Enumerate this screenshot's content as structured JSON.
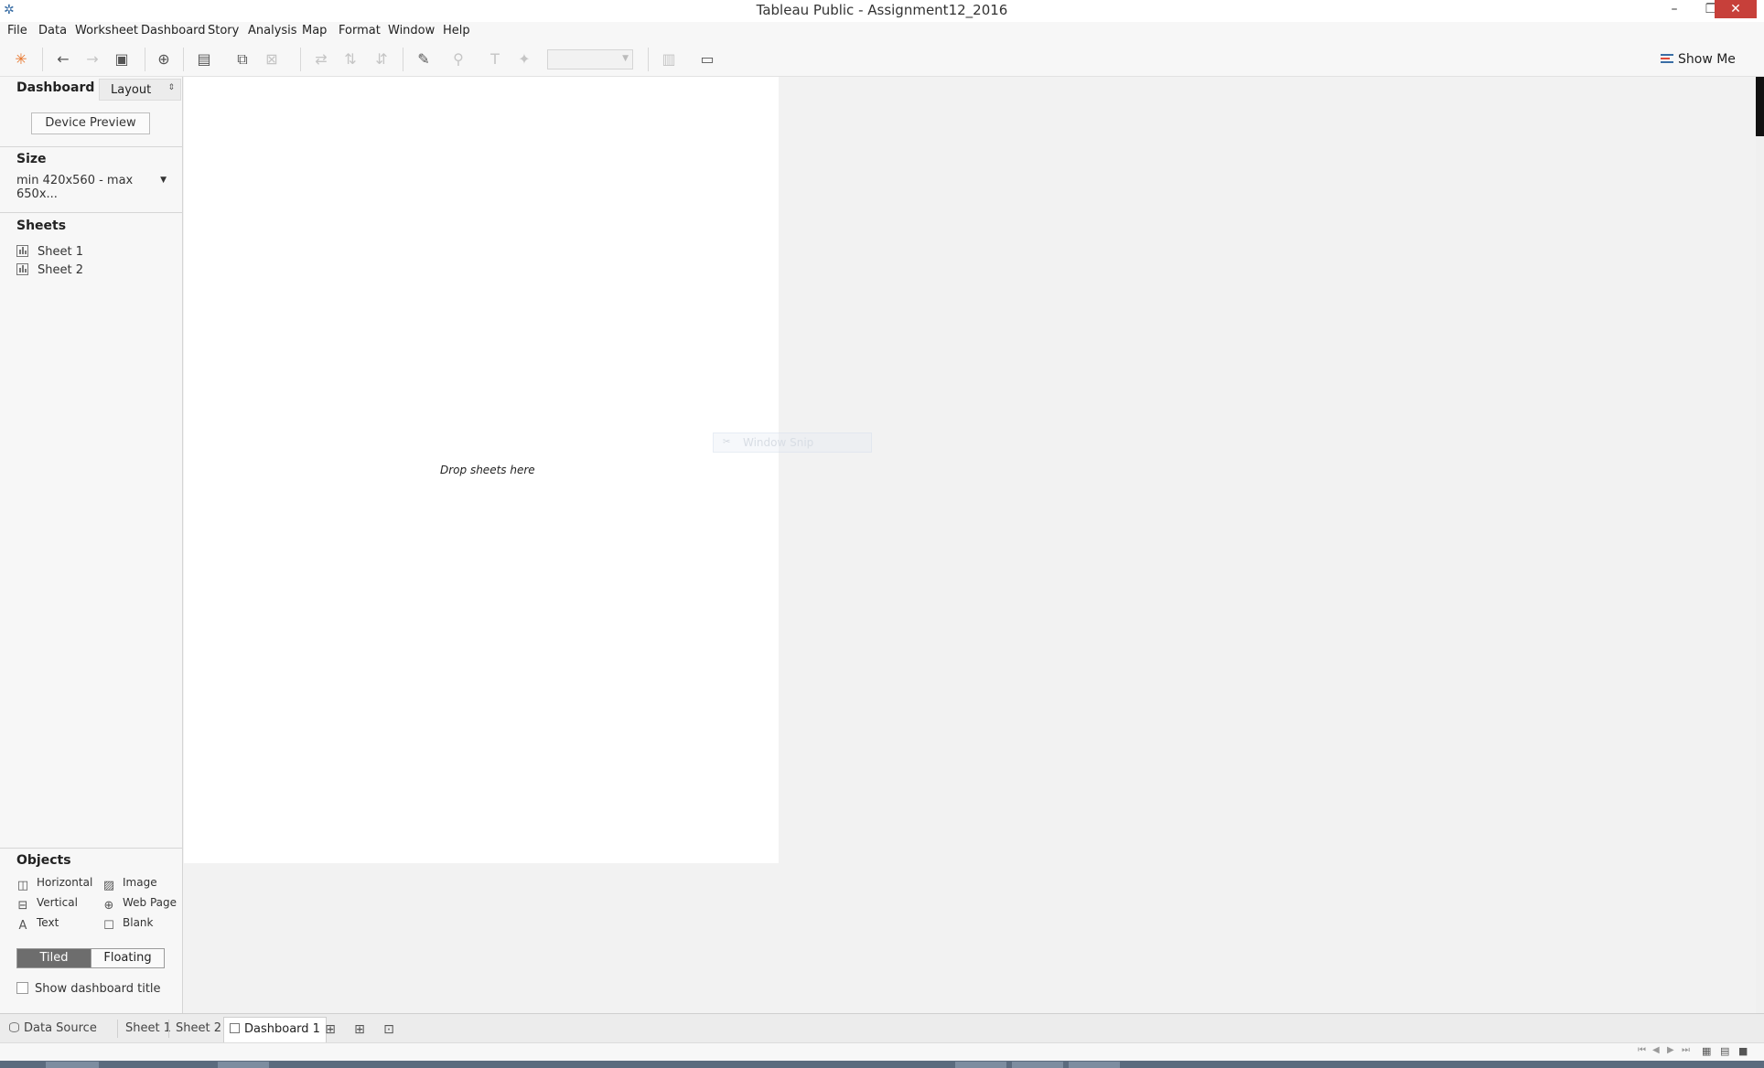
{
  "window": {
    "title": "Tableau Public - Assignment12_2016",
    "minimize": "–",
    "maximize": "❐",
    "close": "✕"
  },
  "menu": [
    "File",
    "Data",
    "Worksheet",
    "Dashboard",
    "Story",
    "Analysis",
    "Map",
    "Format",
    "Window",
    "Help"
  ],
  "toolbar": {
    "show_me_label": "Show Me",
    "icons": [
      "tableau-logo-icon",
      "undo-icon",
      "redo-icon",
      "save-icon",
      "new-data-source-icon",
      "new-worksheet-icon",
      "duplicate-icon",
      "clear-sheet-icon",
      "swap-icon",
      "sort-ascending-icon",
      "sort-descending-icon",
      "highlight-icon",
      "group-icon",
      "label-icon",
      "pin-icon",
      "fit-dropdown",
      "show-cards-icon",
      "presentation-icon"
    ]
  },
  "left_panel": {
    "tab_dashboard": "Dashboard",
    "tab_layout": "Layout",
    "device_preview": "Device Preview",
    "size_title": "Size",
    "size_value": "min 420x560 - max 650x...",
    "sheets_title": "Sheets",
    "sheets": [
      "Sheet 1",
      "Sheet 2"
    ],
    "objects_title": "Objects",
    "objects": [
      {
        "label": "Horizontal",
        "icon": "horizontal-container-icon"
      },
      {
        "label": "Image",
        "icon": "image-icon"
      },
      {
        "label": "Vertical",
        "icon": "vertical-container-icon"
      },
      {
        "label": "Web Page",
        "icon": "globe-icon"
      },
      {
        "label": "Text",
        "icon": "text-icon"
      },
      {
        "label": "Blank",
        "icon": "blank-icon"
      }
    ],
    "tiled_label": "Tiled",
    "floating_label": "Floating",
    "show_title_label": "Show dashboard title"
  },
  "canvas": {
    "drop_hint": "Drop sheets here",
    "ghost_label": "Window Snip"
  },
  "bottom_tabs": {
    "data_source": "Data Source",
    "sheet1": "Sheet 1",
    "sheet2": "Sheet 2",
    "dashboard1": "Dashboard 1"
  },
  "colors": {
    "close_button": "#c7403a",
    "tiled_active": "#6d6d6d",
    "accent_blue": "#3a6ea5"
  }
}
